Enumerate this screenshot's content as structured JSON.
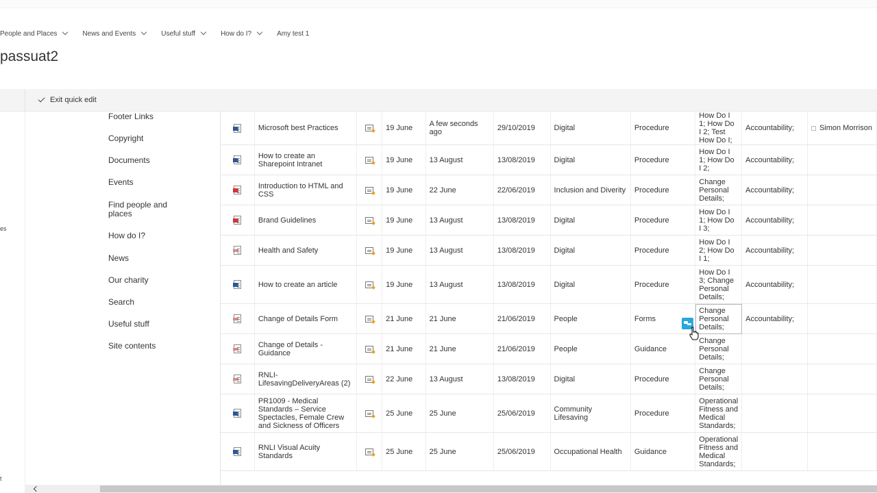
{
  "topnav": {
    "items": [
      {
        "label": "People and Places",
        "has_dropdown": true
      },
      {
        "label": "News and Events",
        "has_dropdown": true
      },
      {
        "label": "Useful stuff",
        "has_dropdown": true
      },
      {
        "label": "How do I?",
        "has_dropdown": true
      },
      {
        "label": "Amy test 1",
        "has_dropdown": false
      }
    ]
  },
  "site": {
    "title": "passuat2"
  },
  "commandbar": {
    "exit_label": "Exit quick edit"
  },
  "leftstub": {
    "text_a": "es",
    "text_b": "t"
  },
  "sidenav": {
    "items": [
      "Footer Links",
      "Copyright",
      "Documents",
      "Events",
      "Find people and places",
      "How do I?",
      "News",
      "Our charity",
      "Search",
      "Useful stuff",
      "Site contents"
    ]
  },
  "grid": {
    "rows": [
      {
        "icon": "word-doc-icon",
        "icon_type": "word",
        "name": "Microsoft best Practices",
        "created": "19 June",
        "modified": "A few seconds ago",
        "date": "29/10/2019",
        "area": "Digital",
        "type": "Procedure",
        "how_do_i": "How Do I 1; How Do I 2; Test How Do I;",
        "value": "Accountability;",
        "person": "Simon Morrison"
      },
      {
        "icon": "word-doc-icon",
        "icon_type": "word",
        "name": "How to create an Sharepoint Intranet",
        "created": "19 June",
        "modified": "13 August",
        "date": "13/08/2019",
        "area": "Digital",
        "type": "Procedure",
        "how_do_i": "How Do I 1; How Do I 2;",
        "value": "Accountability;",
        "person": ""
      },
      {
        "icon": "pdf-icon",
        "icon_type": "pdf",
        "name": "Introduction to HTML and CSS",
        "created": "19 June",
        "modified": "22 June",
        "date": "22/06/2019",
        "area": "Inclusion and Diverity",
        "type": "Procedure",
        "how_do_i": "Change Personal Details;",
        "value": "Accountability;",
        "person": ""
      },
      {
        "icon": "pdf-icon",
        "icon_type": "pdf",
        "name": "Brand Guidelines",
        "created": "19 June",
        "modified": "13 August",
        "date": "13/08/2019",
        "area": "Digital",
        "type": "Procedure",
        "how_do_i": "How Do I 1; How Do I 3;",
        "value": "Accountability;",
        "person": ""
      },
      {
        "icon": "generic-file-icon",
        "icon_type": "generic",
        "name": "Health and Safety",
        "created": "19 June",
        "modified": "13 August",
        "date": "13/08/2019",
        "area": "Digital",
        "type": "Procedure",
        "how_do_i": "How Do I 2; How Do I 1;",
        "value": "Accountability;",
        "person": ""
      },
      {
        "icon": "word-doc-icon",
        "icon_type": "word",
        "name": "How to create an article",
        "created": "19 June",
        "modified": "13 August",
        "date": "13/08/2019",
        "area": "Digital",
        "type": "Procedure",
        "how_do_i": "How Do I 3; Change Personal Details;",
        "value": "Accountability;",
        "person": ""
      },
      {
        "icon": "generic-file-icon",
        "icon_type": "generic",
        "name": "Change of Details Form",
        "created": "21 June",
        "modified": "21 June",
        "date": "21/06/2019",
        "area": "People",
        "type": "Forms",
        "how_do_i": "Change Personal Details;",
        "value": "Accountability;",
        "person": ""
      },
      {
        "icon": "generic-file-icon",
        "icon_type": "generic",
        "name": "Change of Details - Guidance",
        "created": "21 June",
        "modified": "21 June",
        "date": "21/06/2019",
        "area": "People",
        "type": "Guidance",
        "how_do_i": "Change Personal Details;",
        "value": "",
        "person": ""
      },
      {
        "icon": "generic-file-icon",
        "icon_type": "generic",
        "name": "RNLI-LifesavingDeliveryAreas (2)",
        "created": "22 June",
        "modified": "13 August",
        "date": "13/08/2019",
        "area": "Digital",
        "type": "Procedure",
        "how_do_i": "Change Personal Details;",
        "value": "",
        "person": ""
      },
      {
        "icon": "word-doc-icon",
        "icon_type": "word",
        "name": "PR1009 - Medical Standards – Service Spectacles, Female Crew and Sickness of Officers",
        "created": "25 June",
        "modified": "25 June",
        "date": "25/06/2019",
        "area": "Community Lifesaving",
        "type": "Procedure",
        "how_do_i": "Operational Fitness and Medical Standards;",
        "value": "",
        "person": ""
      },
      {
        "icon": "word-doc-icon",
        "icon_type": "word",
        "name": "RNLI Visual Acuity Standards",
        "created": "25 June",
        "modified": "25 June",
        "date": "25/06/2019",
        "area": "Occupational Health",
        "type": "Guidance",
        "how_do_i": "Operational Fitness and Medical Standards;",
        "value": "",
        "person": ""
      }
    ]
  },
  "colors": {
    "accent": "#2ba6de",
    "word": "#2b5797",
    "pdf": "#d13438"
  }
}
